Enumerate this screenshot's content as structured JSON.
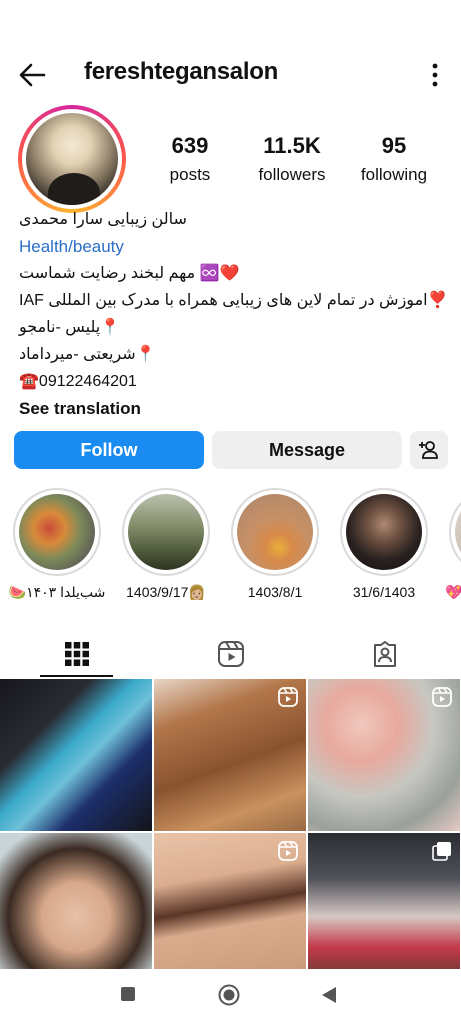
{
  "header": {
    "username": "fereshtegansalon"
  },
  "profile": {
    "stats": [
      {
        "value": "639",
        "label": "posts"
      },
      {
        "value": "11.5K",
        "label": "followers"
      },
      {
        "value": "95",
        "label": "following"
      }
    ],
    "bio": {
      "name": "سالن زیبایی سارا محمدی",
      "category": "Health/beauty",
      "line1": "❤️♾️ مهم لبخند رضایت شماست",
      "line2": "IAF اموزش در تمام لاین های زیبایی همراه با مدرک بین المللی❣️",
      "line3": "📍پلیس -نامجو",
      "line4": "📍شریعتی -میرداماد",
      "phone": "☎️09122464201",
      "see_translation": "See translation"
    }
  },
  "actions": {
    "follow": "Follow",
    "message": "Message"
  },
  "highlights": [
    {
      "caption": "🍉شب‌یلدا ۱۴۰۳"
    },
    {
      "caption": "1403/9/17👩🏼"
    },
    {
      "caption": "1403/8/1"
    },
    {
      "caption": "31/6/1403"
    },
    {
      "caption": "💖"
    }
  ],
  "tabs": [
    "posts-grid",
    "reels",
    "tagged"
  ],
  "colors": {
    "accent": "#1a8cf1",
    "category_link": "#2b6ec7"
  }
}
